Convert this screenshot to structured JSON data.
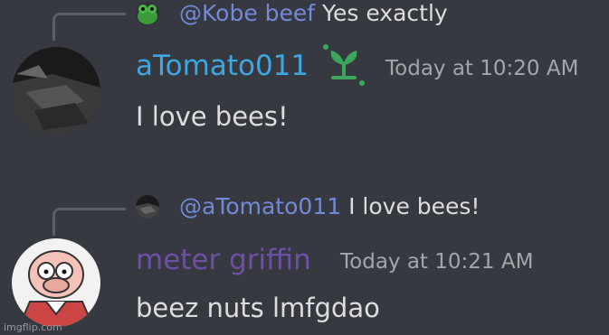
{
  "messages": [
    {
      "reply": {
        "mention": "@Kobe beef",
        "text": "Yes exactly"
      },
      "author": {
        "name": "aTomato011",
        "color": "#3ea6e0"
      },
      "timestamp": "Today at 10:20 AM",
      "content": "I love bees!",
      "badge_icon": "sprout-icon"
    },
    {
      "reply": {
        "mention": "@aTomato011",
        "text": "I love bees!"
      },
      "author": {
        "name": "meter griffin",
        "color": "#6f4fa6"
      },
      "timestamp": "Today at 10:21 AM",
      "content": "beez nuts lmfgdao"
    }
  ],
  "watermark": "imgflip.com"
}
